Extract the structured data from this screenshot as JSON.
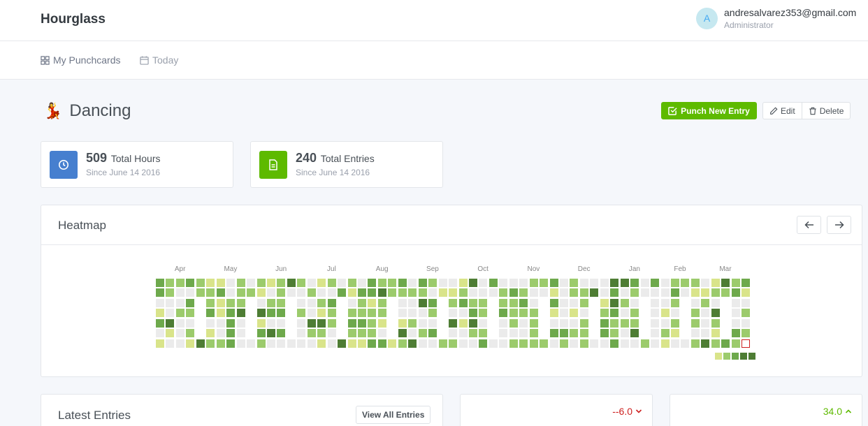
{
  "header": {
    "brand": "Hourglass",
    "avatar_letter": "A",
    "user_email": "andresalvarez353@gmail.com",
    "user_role": "Administrator"
  },
  "nav": {
    "items": [
      {
        "label": "My Punchcards",
        "icon": "grid-icon"
      },
      {
        "label": "Today",
        "icon": "calendar-icon"
      }
    ]
  },
  "page": {
    "emoji": "💃",
    "title": "Dancing",
    "punch_label": "Punch New Entry",
    "edit_label": "Edit",
    "delete_label": "Delete"
  },
  "stats": [
    {
      "value": "509",
      "label": "Total Hours",
      "since": "Since June 14 2016",
      "icon": "clock-icon",
      "color": "#467fcf"
    },
    {
      "value": "240",
      "label": "Total Entries",
      "since": "Since June 14 2016",
      "icon": "document-icon",
      "color": "#5eba00"
    }
  ],
  "heatmap": {
    "title": "Heatmap",
    "months": [
      "Apr",
      "May",
      "Jun",
      "Jul",
      "Aug",
      "Sep",
      "Oct",
      "Nov",
      "Dec",
      "Jan",
      "Feb",
      "Mar"
    ],
    "colors": [
      "#ebedf0",
      "#d6e685",
      "#8cc665",
      "#44a340",
      "#1e6823"
    ],
    "cell_colors": {
      "empty": "#ebebeb",
      "level1": "#d9e48a",
      "level2": "#9ccb6c",
      "level3": "#6ea94c",
      "level4": "#4e7d34"
    },
    "today_marker_color": "#cd201f"
  },
  "latest": {
    "title": "Latest Entries",
    "view_all_label": "View All Entries"
  },
  "metrics": [
    {
      "delta": "--6.0",
      "direction": "down"
    },
    {
      "delta": "34.0",
      "direction": "up"
    }
  ]
}
